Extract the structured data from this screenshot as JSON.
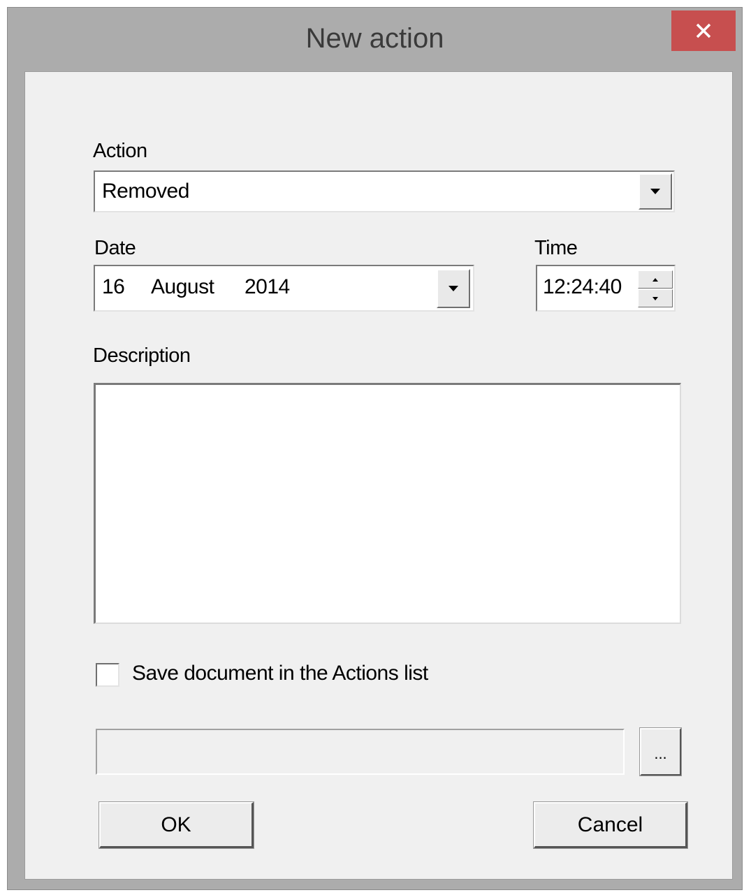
{
  "window": {
    "title": "New action",
    "close_glyph": "✕"
  },
  "action": {
    "label": "Action",
    "selected_value": "Removed"
  },
  "date": {
    "label": "Date",
    "day": "16",
    "month": "August",
    "year": "2014"
  },
  "time": {
    "label": "Time",
    "value": "12:24:40"
  },
  "description": {
    "label": "Description",
    "value": ""
  },
  "save_document": {
    "label": "Save document in the Actions list",
    "checked": false
  },
  "document_path": {
    "value": "",
    "browse_label": "..."
  },
  "buttons": {
    "ok": "OK",
    "cancel": "Cancel"
  },
  "icons": {
    "close": "close-icon",
    "dropdown": "chevron-down-icon",
    "spin_up": "spin-up-icon",
    "spin_down": "spin-down-icon"
  },
  "colors": {
    "close_button": "#c74f4f",
    "frame": "#acacac",
    "client": "#f0f0f0"
  }
}
